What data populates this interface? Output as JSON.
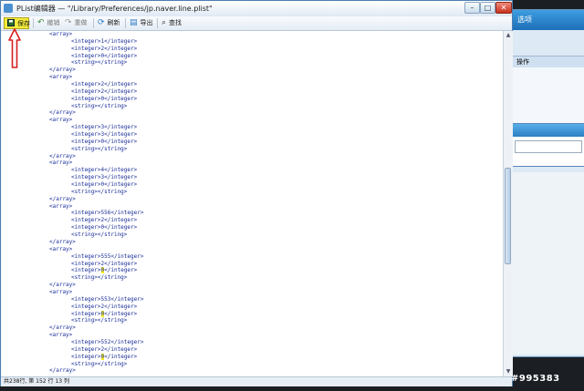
{
  "window": {
    "title": "PList编辑器 — \"/Library/Preferences/jp.naver.line.plist\"",
    "controls": {
      "minimize": "–",
      "maximize": "□",
      "close": "✕"
    }
  },
  "toolbar": {
    "save": "保存",
    "undo": "撤销",
    "redo": "重做",
    "refresh": "刷新",
    "export": "导出",
    "find": "查找"
  },
  "icons": {
    "save": "floppy-disk-icon",
    "undo": "undo-icon",
    "redo": "redo-icon",
    "refresh": "refresh-icon",
    "export": "export-icon",
    "find": "magnifier-icon"
  },
  "editor": {
    "lines": [
      {
        "indent": 8,
        "text": "<array>"
      },
      {
        "indent": 12,
        "text": "<integer>1</integer>"
      },
      {
        "indent": 12,
        "text": "<integer>2</integer>"
      },
      {
        "indent": 12,
        "text": "<integer>0</integer>"
      },
      {
        "indent": 12,
        "text": "<string></string>"
      },
      {
        "indent": 8,
        "text": "</array>"
      },
      {
        "indent": 8,
        "text": "<array>"
      },
      {
        "indent": 12,
        "text": "<integer>2</integer>"
      },
      {
        "indent": 12,
        "text": "<integer>2</integer>"
      },
      {
        "indent": 12,
        "text": "<integer>0</integer>"
      },
      {
        "indent": 12,
        "text": "<string></string>"
      },
      {
        "indent": 8,
        "text": "</array>"
      },
      {
        "indent": 8,
        "text": "<array>"
      },
      {
        "indent": 12,
        "text": "<integer>3</integer>"
      },
      {
        "indent": 12,
        "text": "<integer>3</integer>"
      },
      {
        "indent": 12,
        "text": "<integer>0</integer>"
      },
      {
        "indent": 12,
        "text": "<string></string>"
      },
      {
        "indent": 8,
        "text": "</array>"
      },
      {
        "indent": 8,
        "text": "<array>"
      },
      {
        "indent": 12,
        "text": "<integer>4</integer>"
      },
      {
        "indent": 12,
        "text": "<integer>3</integer>"
      },
      {
        "indent": 12,
        "text": "<integer>0</integer>"
      },
      {
        "indent": 12,
        "text": "<string></string>"
      },
      {
        "indent": 8,
        "text": "</array>"
      },
      {
        "indent": 8,
        "text": "<array>"
      },
      {
        "indent": 12,
        "text": "<integer>556</integer>"
      },
      {
        "indent": 12,
        "text": "<integer>2</integer>"
      },
      {
        "indent": 12,
        "text": "<integer>0</integer>"
      },
      {
        "indent": 12,
        "text": "<string></string>"
      },
      {
        "indent": 8,
        "text": "</array>"
      },
      {
        "indent": 8,
        "text": "<array>"
      },
      {
        "indent": 12,
        "text": "<integer>555</integer>"
      },
      {
        "indent": 12,
        "text": "<integer>2</integer>"
      },
      {
        "indent": 12,
        "pre": "<integer>",
        "hl": "0",
        "post": "</integer>"
      },
      {
        "indent": 12,
        "text": "<string></string>"
      },
      {
        "indent": 8,
        "text": "</array>"
      },
      {
        "indent": 8,
        "text": "<array>"
      },
      {
        "indent": 12,
        "text": "<integer>553</integer>"
      },
      {
        "indent": 12,
        "text": "<integer>2</integer>"
      },
      {
        "indent": 12,
        "pre": "<integer>",
        "hl": "0",
        "post": "</integer>"
      },
      {
        "indent": 12,
        "text": "<string></string>"
      },
      {
        "indent": 8,
        "text": "</array>"
      },
      {
        "indent": 8,
        "text": "<array>"
      },
      {
        "indent": 12,
        "text": "<integer>552</integer>"
      },
      {
        "indent": 12,
        "text": "<integer>2</integer>"
      },
      {
        "indent": 12,
        "pre": "<integer>",
        "hl": "0",
        "post": "</integer>"
      },
      {
        "indent": 12,
        "text": "<string></string>"
      },
      {
        "indent": 8,
        "text": "</array>"
      }
    ]
  },
  "status": {
    "text": "共238行, 第 152 行 13 列"
  },
  "background_window": {
    "title": "选项",
    "panel_header": "操作"
  },
  "watermark": "#995383",
  "colors": {
    "save_highlight": "#f4ec3a",
    "code_text": "#1a2e99",
    "arrow": "#d81e1e"
  }
}
